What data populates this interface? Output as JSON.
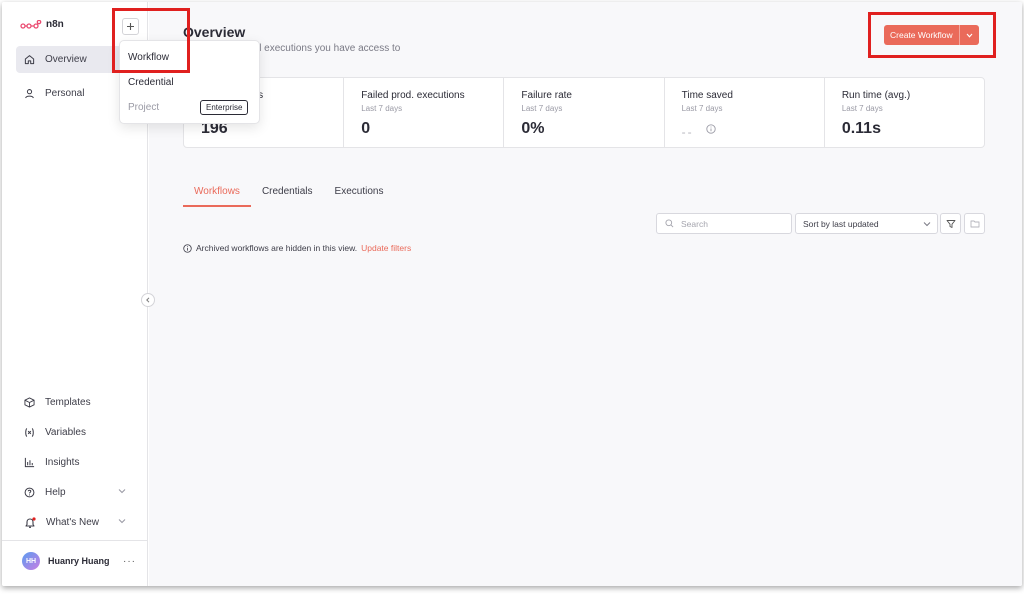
{
  "app": {
    "logo_text": "n8n"
  },
  "sidebar": {
    "items": [
      {
        "label": "Overview",
        "icon": "home-icon",
        "active": true
      },
      {
        "label": "Personal",
        "icon": "user-icon",
        "active": false
      }
    ],
    "bottom_items": [
      {
        "label": "Templates",
        "icon": "box-icon"
      },
      {
        "label": "Variables",
        "icon": "variables-icon"
      },
      {
        "label": "Insights",
        "icon": "chart-icon"
      },
      {
        "label": "Help",
        "icon": "help-circle-icon",
        "chevron": true
      },
      {
        "label": "What's New",
        "icon": "bell-icon",
        "chevron": true,
        "notification_dot": true
      }
    ],
    "user": {
      "initials": "HH",
      "name": "Huanry Huang",
      "more": "···"
    }
  },
  "new_menu": {
    "items": [
      {
        "label": "Workflow"
      },
      {
        "label": "Credential"
      },
      {
        "label": "Project",
        "disabled": true,
        "badge": "Enterprise"
      }
    ]
  },
  "header": {
    "title": "Overview",
    "subtitle": "s, credentials and executions you have access to",
    "create_button": "Create Workflow"
  },
  "stats": [
    {
      "label": "ons",
      "sub": "",
      "value": "196"
    },
    {
      "label": "Failed prod. executions",
      "sub": "Last 7 days",
      "value": "0"
    },
    {
      "label": "Failure rate",
      "sub": "Last 7 days",
      "value": "0%"
    },
    {
      "label": "Time saved",
      "sub": "Last 7 days",
      "value": "--"
    },
    {
      "label": "Run time (avg.)",
      "sub": "Last 7 days",
      "value": "0.11s"
    }
  ],
  "tabs": [
    {
      "label": "Workflows",
      "active": true
    },
    {
      "label": "Credentials",
      "active": false
    },
    {
      "label": "Executions",
      "active": false
    }
  ],
  "toolbar": {
    "search_placeholder": "Search",
    "sort_value": "Sort by last updated"
  },
  "notice": {
    "text": "Archived workflows are hidden in this view.",
    "link": "Update filters"
  },
  "colors": {
    "accent": "#ea6a5a",
    "highlight": "#e0201f"
  }
}
